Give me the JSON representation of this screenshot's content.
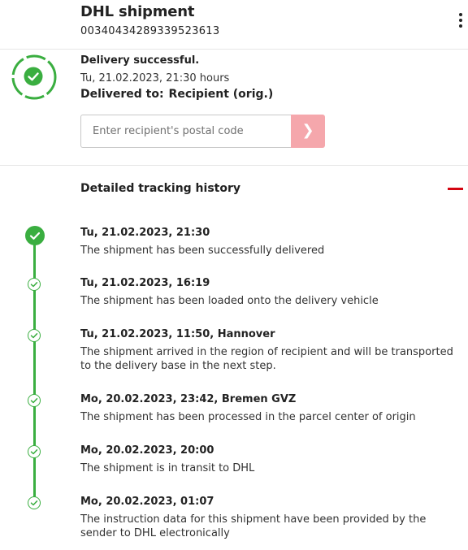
{
  "header": {
    "title": "DHL shipment",
    "tracking_number": "00340434289339523613"
  },
  "status": {
    "headline": "Delivery successful.",
    "timestamp": "Tu, 21.02.2023, 21:30 hours",
    "delivered_to_label": "Delivered to:",
    "delivered_to_value": "Recipient (orig.)",
    "postal_placeholder": "Enter recipient's postal code",
    "submit_glyph": "❯"
  },
  "history": {
    "title": "Detailed tracking history",
    "events": [
      {
        "when": "Tu, 21.02.2023, 21:30",
        "what": "The shipment has been successfully delivered"
      },
      {
        "when": "Tu, 21.02.2023, 16:19",
        "what": "The shipment has been loaded onto the delivery vehicle"
      },
      {
        "when": "Tu, 21.02.2023, 11:50, Hannover",
        "what": "The shipment arrived in the region of recipient and will be transported to the delivery base in the next step."
      },
      {
        "when": "Mo, 20.02.2023, 23:42, Bremen GVZ",
        "what": "The shipment has been processed in the parcel center of origin"
      },
      {
        "when": "Mo, 20.02.2023, 20:00",
        "what": "The shipment is in transit to DHL"
      },
      {
        "when": "Mo, 20.02.2023, 01:07",
        "what": "The instruction data for this shipment have been provided by the sender to DHL electronically"
      }
    ]
  },
  "colors": {
    "success_green": "#3aae40",
    "dhl_red": "#d40511",
    "button_pink": "#f5a7ac"
  }
}
